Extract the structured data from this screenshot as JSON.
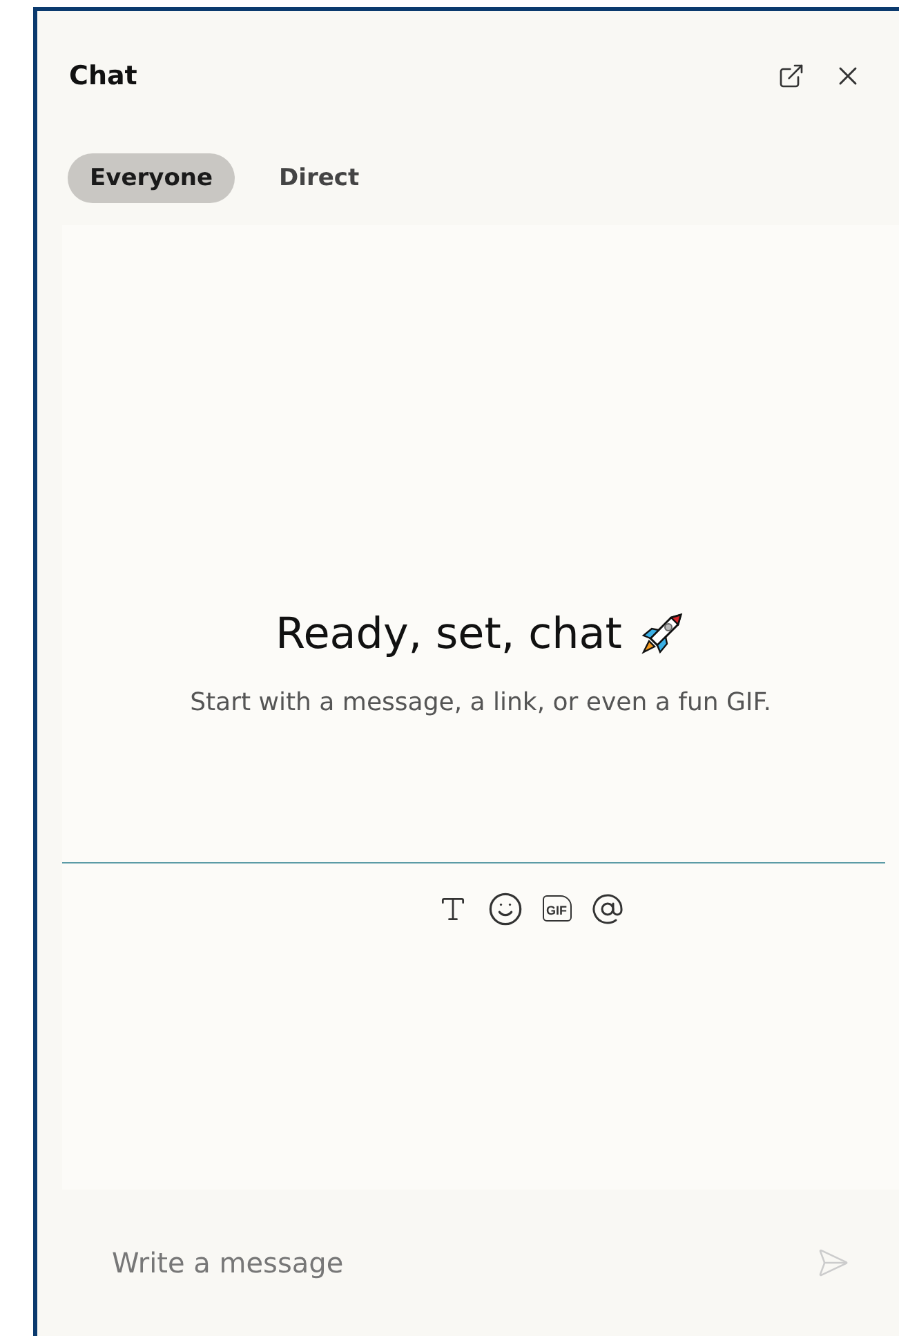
{
  "header": {
    "title": "Chat"
  },
  "tabs": [
    {
      "label": "Everyone",
      "selected": true
    },
    {
      "label": "Direct",
      "selected": false
    }
  ],
  "empty_state": {
    "heading": "Ready, set, chat",
    "text": "Start with a message, a link, or even a fun GIF."
  },
  "toolbar": [
    {
      "kind": "format"
    },
    {
      "kind": "emoji"
    },
    {
      "kind": "gif",
      "label": "GIF"
    },
    {
      "kind": "mention"
    }
  ],
  "composer": {
    "placeholder": "Write a message"
  }
}
